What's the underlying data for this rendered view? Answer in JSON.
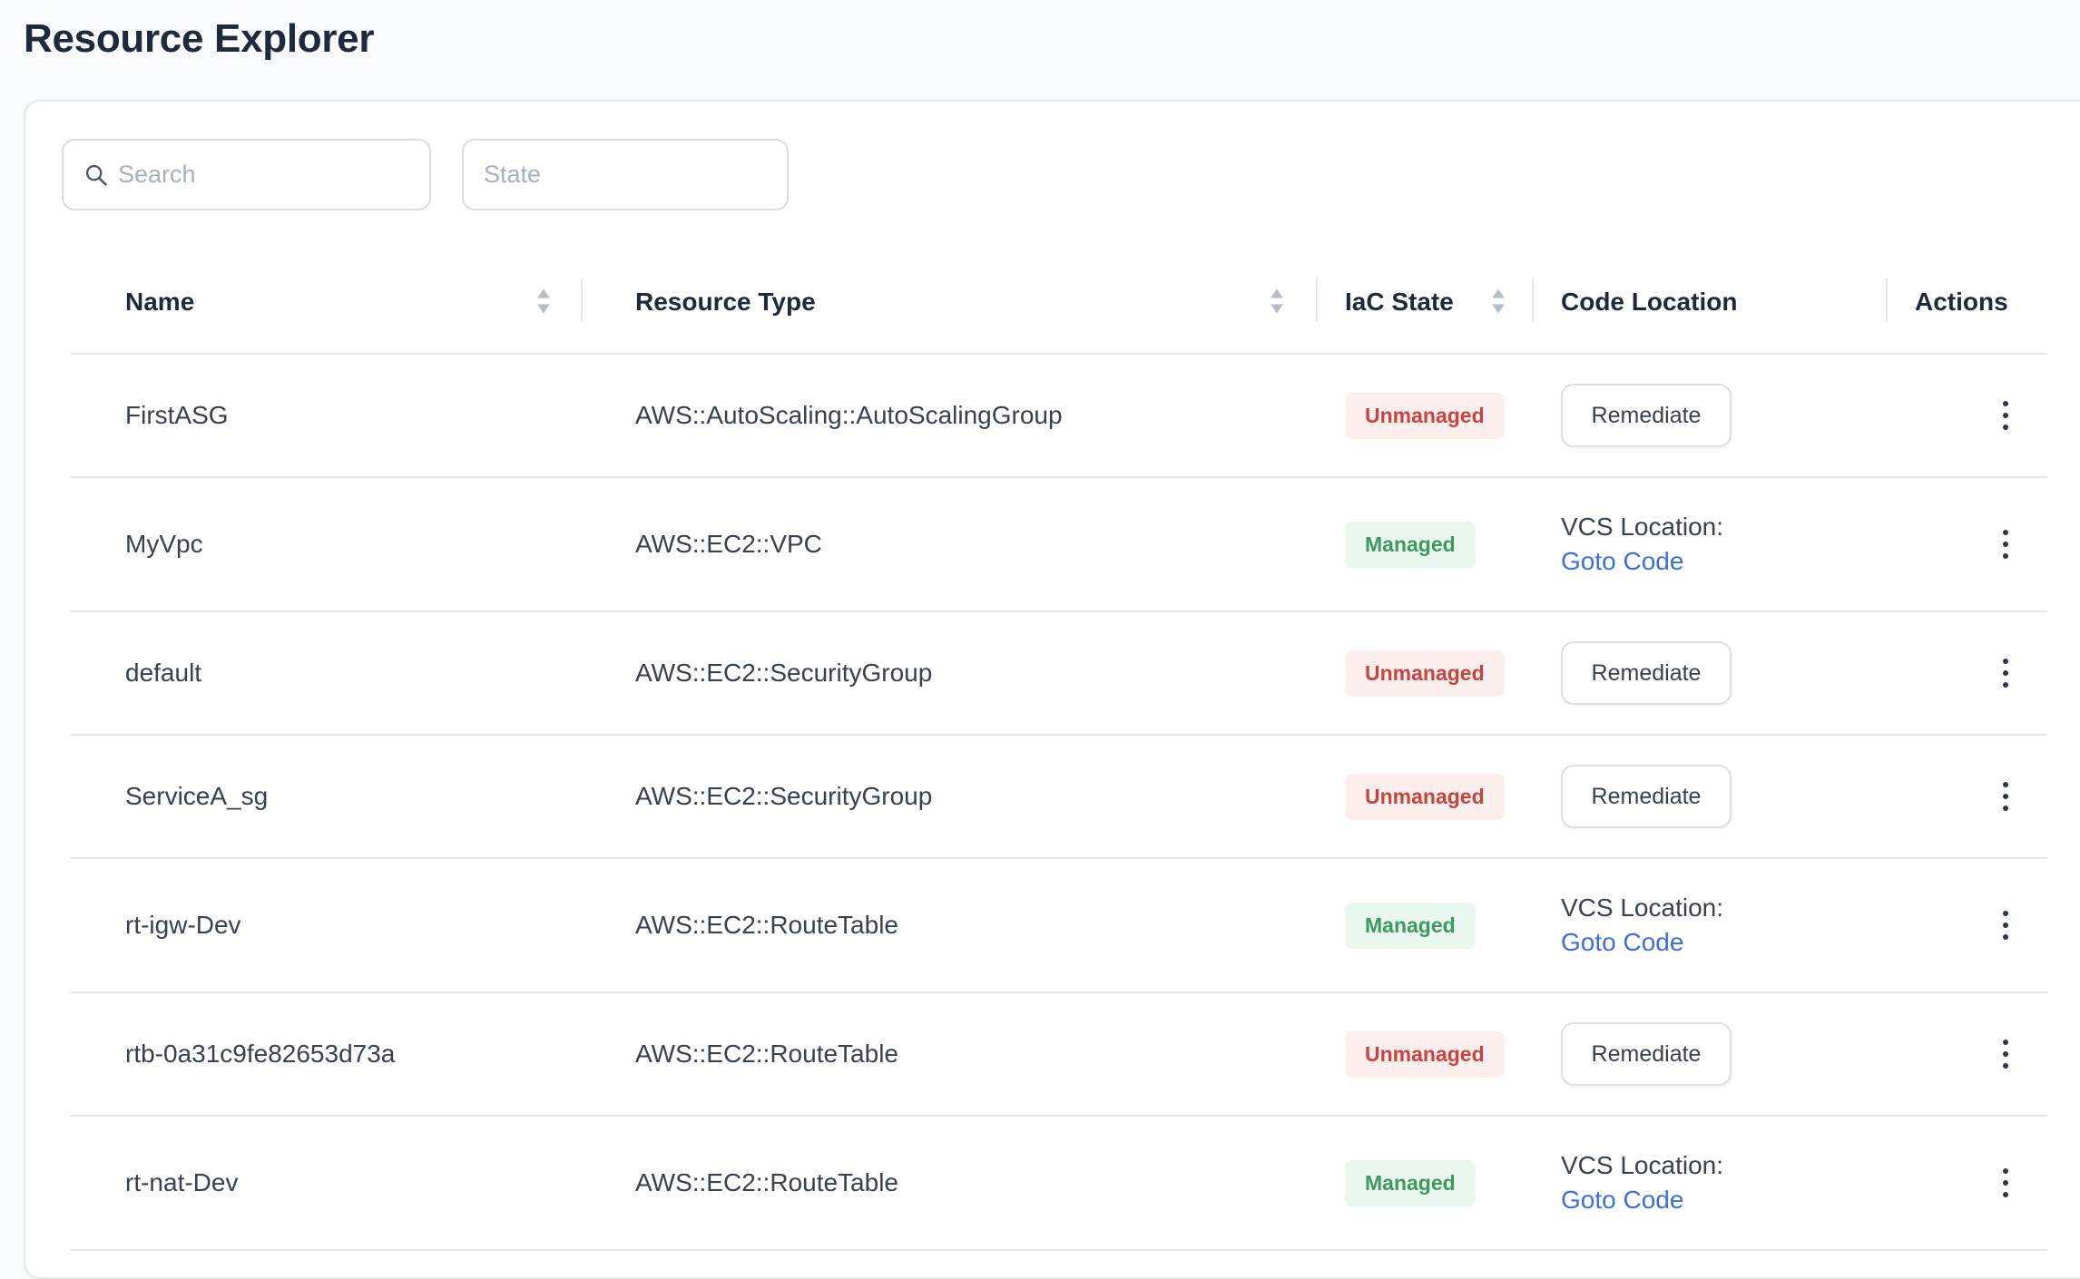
{
  "page": {
    "title": "Resource Explorer"
  },
  "filters": {
    "search_placeholder": "Search",
    "search_icon": "search-icon",
    "state_placeholder": "State"
  },
  "table": {
    "columns": [
      {
        "label": "Name",
        "sortable": true
      },
      {
        "label": "Resource Type",
        "sortable": true
      },
      {
        "label": "IaC State",
        "sortable": true
      },
      {
        "label": "Code Location",
        "sortable": false
      },
      {
        "label": "Actions",
        "sortable": false
      }
    ],
    "rows": [
      {
        "name": "FirstASG",
        "type": "AWS::AutoScaling::AutoScalingGroup",
        "state": "Unmanaged",
        "remediate_label": "Remediate"
      },
      {
        "name": "MyVpc",
        "type": "AWS::EC2::VPC",
        "state": "Managed",
        "vcs_label": "VCS Location:",
        "vcs_link": "Goto Code"
      },
      {
        "name": "default",
        "type": "AWS::EC2::SecurityGroup",
        "state": "Unmanaged",
        "remediate_label": "Remediate"
      },
      {
        "name": "ServiceA_sg",
        "type": "AWS::EC2::SecurityGroup",
        "state": "Unmanaged",
        "remediate_label": "Remediate"
      },
      {
        "name": "rt-igw-Dev",
        "type": "AWS::EC2::RouteTable",
        "state": "Managed",
        "vcs_label": "VCS Location:",
        "vcs_link": "Goto Code"
      },
      {
        "name": "rtb-0a31c9fe82653d73a",
        "type": "AWS::EC2::RouteTable",
        "state": "Unmanaged",
        "remediate_label": "Remediate"
      },
      {
        "name": "rt-nat-Dev",
        "type": "AWS::EC2::RouteTable",
        "state": "Managed",
        "vcs_label": "VCS Location:",
        "vcs_link": "Goto Code"
      }
    ]
  },
  "colors": {
    "unmanaged_text": "#c8443f",
    "unmanaged_bg": "#fdeeee",
    "managed_text": "#3c9a5f",
    "managed_bg": "#eaf7ee",
    "link": "#3b6fe0"
  }
}
